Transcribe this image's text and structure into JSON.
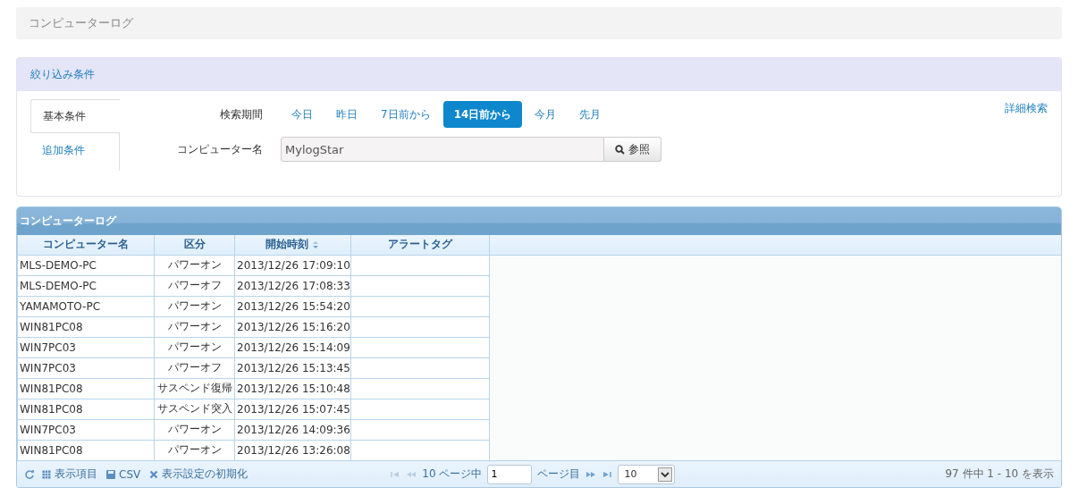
{
  "page_title": "コンピューターログ",
  "filter": {
    "title": "絞り込み条件",
    "tabs": [
      {
        "label": "基本条件",
        "selected": true
      },
      {
        "label": "追加条件",
        "selected": false
      }
    ],
    "period_label": "検索期間",
    "periods": [
      {
        "label": "今日",
        "selected": false
      },
      {
        "label": "昨日",
        "selected": false
      },
      {
        "label": "7日前から",
        "selected": false
      },
      {
        "label": "14日前から",
        "selected": true
      },
      {
        "label": "今月",
        "selected": false
      },
      {
        "label": "先月",
        "selected": false
      }
    ],
    "computer_label": "コンピューター名",
    "computer_value": "MylogStar",
    "browse_button": "参照",
    "advanced_link": "詳細検索"
  },
  "grid": {
    "title": "コンピューターログ",
    "columns": [
      {
        "label": "コンピューター名",
        "sortable": false
      },
      {
        "label": "区分",
        "sortable": false
      },
      {
        "label": "開始時刻",
        "sortable": true
      },
      {
        "label": "アラートタグ",
        "sortable": false
      }
    ],
    "rows": [
      [
        "MLS-DEMO-PC",
        "パワーオン",
        "2013/12/26 17:09:10",
        ""
      ],
      [
        "MLS-DEMO-PC",
        "パワーオフ",
        "2013/12/26 17:08:33",
        ""
      ],
      [
        "YAMAMOTO-PC",
        "パワーオン",
        "2013/12/26 15:54:20",
        ""
      ],
      [
        "WIN81PC08",
        "パワーオン",
        "2013/12/26 15:16:20",
        ""
      ],
      [
        "WIN7PC03",
        "パワーオン",
        "2013/12/26 15:14:09",
        ""
      ],
      [
        "WIN7PC03",
        "パワーオフ",
        "2013/12/26 15:13:45",
        ""
      ],
      [
        "WIN81PC08",
        "サスペンド復帰",
        "2013/12/26 15:10:48",
        ""
      ],
      [
        "WIN81PC08",
        "サスペンド突入",
        "2013/12/26 15:07:45",
        ""
      ],
      [
        "WIN7PC03",
        "パワーオン",
        "2013/12/26 14:09:36",
        ""
      ],
      [
        "WIN81PC08",
        "パワーオン",
        "2013/12/26 13:26:08",
        ""
      ]
    ],
    "footer": {
      "columns_button": "表示項目",
      "csv_button": "CSV",
      "reset_button": "表示設定の初期化",
      "page_count": "10 ページ中",
      "page_value": "1",
      "page_suffix": "ページ目",
      "page_size": "10",
      "summary": "97 件中 1 - 10 を表示"
    }
  }
}
